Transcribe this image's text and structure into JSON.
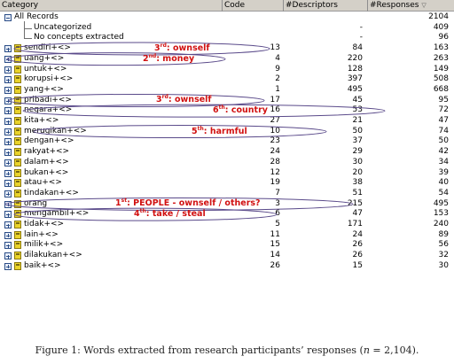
{
  "header": {
    "category": "Category",
    "code": "Code",
    "descriptors": "#Descriptors",
    "responses": "#Responses",
    "sort_icon": "sort-descending-icon"
  },
  "root": {
    "label": "All Records",
    "code": "",
    "descriptors": "",
    "responses": "2104"
  },
  "special_rows": [
    {
      "label": "Uncategorized",
      "code": "",
      "descriptors": "-",
      "responses": "409"
    },
    {
      "label": "No concepts extracted",
      "code": "",
      "descriptors": "-",
      "responses": "96"
    }
  ],
  "rows": [
    {
      "label": "sendiri+<>",
      "code": "13",
      "descriptors": "84",
      "responses": "163"
    },
    {
      "label": "uang+<>",
      "code": "4",
      "descriptors": "220",
      "responses": "263"
    },
    {
      "label": "untuk+<>",
      "code": "9",
      "descriptors": "128",
      "responses": "149"
    },
    {
      "label": "korupsi+<>",
      "code": "2",
      "descriptors": "397",
      "responses": "508"
    },
    {
      "label": "yang+<>",
      "code": "1",
      "descriptors": "495",
      "responses": "668"
    },
    {
      "label": "pribadi+<>",
      "code": "17",
      "descriptors": "45",
      "responses": "95"
    },
    {
      "label": "negara+<>",
      "code": "16",
      "descriptors": "53",
      "responses": "72"
    },
    {
      "label": "kita+<>",
      "code": "27",
      "descriptors": "21",
      "responses": "47"
    },
    {
      "label": "merugikan+<>",
      "code": "10",
      "descriptors": "50",
      "responses": "74"
    },
    {
      "label": "dengan+<>",
      "code": "23",
      "descriptors": "37",
      "responses": "50"
    },
    {
      "label": "rakyat+<>",
      "code": "24",
      "descriptors": "29",
      "responses": "42"
    },
    {
      "label": "dalam+<>",
      "code": "28",
      "descriptors": "30",
      "responses": "34"
    },
    {
      "label": "bukan+<>",
      "code": "12",
      "descriptors": "20",
      "responses": "39"
    },
    {
      "label": "atau+<>",
      "code": "19",
      "descriptors": "38",
      "responses": "40"
    },
    {
      "label": "tindakan+<>",
      "code": "7",
      "descriptors": "51",
      "responses": "54"
    },
    {
      "label": "orang",
      "code": "3",
      "descriptors": "215",
      "responses": "495"
    },
    {
      "label": "mengambil+<>",
      "code": "6",
      "descriptors": "47",
      "responses": "153"
    },
    {
      "label": "tidak+<>",
      "code": "5",
      "descriptors": "171",
      "responses": "240"
    },
    {
      "label": "lain+<>",
      "code": "11",
      "descriptors": "24",
      "responses": "89"
    },
    {
      "label": "milik+<>",
      "code": "15",
      "descriptors": "26",
      "responses": "56"
    },
    {
      "label": "dilakukan+<>",
      "code": "14",
      "descriptors": "26",
      "responses": "32"
    },
    {
      "label": "baik+<>",
      "code": "26",
      "descriptors": "15",
      "responses": "30"
    }
  ],
  "annotations": [
    {
      "rank": "3",
      "suffix": "rd",
      "text": ": ownself"
    },
    {
      "rank": "2",
      "suffix": "nd",
      "text": ": money"
    },
    {
      "rank": "3",
      "suffix": "rd",
      "text": ": ownself"
    },
    {
      "rank": "6",
      "suffix": "th",
      "text": ": country"
    },
    {
      "rank": "5",
      "suffix": "th",
      "text": ": harmful"
    },
    {
      "rank": "1",
      "suffix": "st",
      "text": ": PEOPLE - ownself / others?"
    },
    {
      "rank": "4",
      "suffix": "th",
      "text": ": take / steal"
    }
  ],
  "annotation_color": "#d11111",
  "caption": {
    "prefix": "Figure 1: Words extracted from research participants’ responses (",
    "n_label": "n",
    "suffix": " = 2,104)."
  }
}
